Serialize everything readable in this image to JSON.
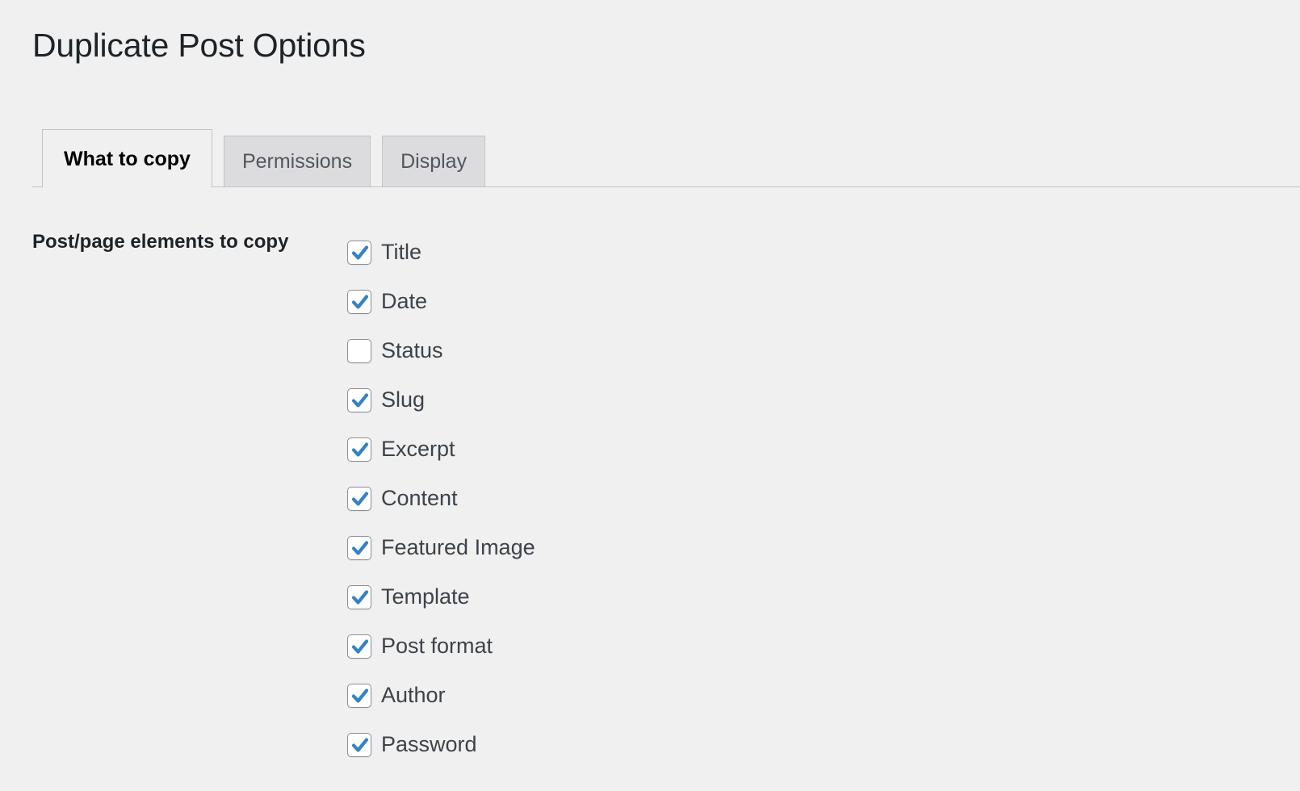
{
  "page": {
    "title": "Duplicate Post Options"
  },
  "tabs": [
    {
      "label": "What to copy",
      "active": true
    },
    {
      "label": "Permissions",
      "active": false
    },
    {
      "label": "Display",
      "active": false
    }
  ],
  "settings": {
    "elements_field": {
      "label": "Post/page elements to copy",
      "options": [
        {
          "label": "Title",
          "checked": true
        },
        {
          "label": "Date",
          "checked": true
        },
        {
          "label": "Status",
          "checked": false
        },
        {
          "label": "Slug",
          "checked": true
        },
        {
          "label": "Excerpt",
          "checked": true
        },
        {
          "label": "Content",
          "checked": true
        },
        {
          "label": "Featured Image",
          "checked": true
        },
        {
          "label": "Template",
          "checked": true
        },
        {
          "label": "Post format",
          "checked": true
        },
        {
          "label": "Author",
          "checked": true
        },
        {
          "label": "Password",
          "checked": true
        }
      ]
    }
  },
  "icons": {
    "checkmark": "check-icon"
  },
  "colors": {
    "page_background": "#f0f0f1",
    "tab_inactive_background": "#dcdcde",
    "tab_active_background": "#f0f0f1",
    "border": "#c3c4c7",
    "checkbox_border": "#8c8f94",
    "checkbox_check": "#3582c4",
    "title_text": "#1d2327",
    "label_text": "#3c434a"
  }
}
